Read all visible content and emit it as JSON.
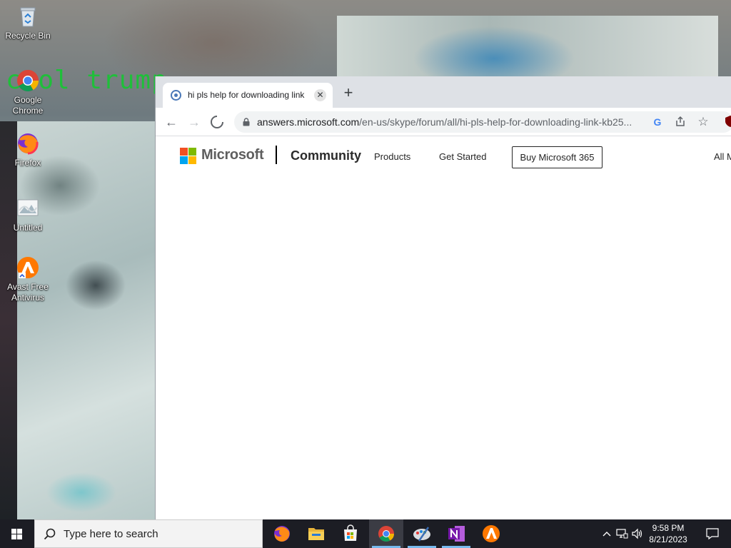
{
  "desktop": {
    "wallpaper_text": "cool trump",
    "icons": [
      {
        "label": "Recycle Bin",
        "icon": "recycle-bin-icon"
      },
      {
        "label": "Google Chrome",
        "icon": "chrome-icon"
      },
      {
        "label": "Firefox",
        "icon": "firefox-icon"
      },
      {
        "label": "Untitled",
        "icon": "image-file-icon"
      },
      {
        "label": "Avast Free Antivirus",
        "icon": "avast-icon"
      }
    ]
  },
  "browser": {
    "tab": {
      "title": "hi pls help for downloading link",
      "favicon": "loading-favicon-icon",
      "close_glyph": "✕"
    },
    "new_tab_glyph": "+",
    "toolbar": {
      "back_glyph": "←",
      "forward_glyph": "→",
      "reload_state": "loading"
    },
    "omnibox": {
      "url_host": "answers.microsoft.com",
      "url_path": "/en-us/skype/forum/all/hi-pls-help-for-downloading-link-kb25...",
      "icons": [
        "google-icon",
        "share-icon",
        "bookmark-star-icon",
        "ublock-icon"
      ]
    }
  },
  "page": {
    "brand": "Microsoft",
    "section": "Community",
    "nav": {
      "products": "Products",
      "get_started": "Get Started",
      "buy": "Buy Microsoft 365",
      "all_ms": "All M"
    },
    "logo_colors": [
      "#f25022",
      "#7fba00",
      "#00a4ef",
      "#ffb900"
    ]
  },
  "taskbar": {
    "search_placeholder": "Type here to search",
    "apps": [
      {
        "name": "firefox-taskbar-icon",
        "running": false
      },
      {
        "name": "file-explorer-taskbar-icon",
        "running": false
      },
      {
        "name": "microsoft-store-taskbar-icon",
        "running": false
      },
      {
        "name": "chrome-taskbar-icon",
        "running": true,
        "active": true
      },
      {
        "name": "paint-taskbar-icon",
        "running": true
      },
      {
        "name": "onenote-taskbar-icon",
        "running": true
      },
      {
        "name": "avast-taskbar-icon",
        "running": false
      }
    ],
    "clock": {
      "time": "9:58 PM",
      "date": "8/21/2023"
    }
  },
  "colors": {
    "accent": "#0078d4",
    "taskbar_bg": "#1c1d24",
    "tabstrip_bg": "#dee1e6",
    "wallpaper_text": "#1fbf3a"
  }
}
